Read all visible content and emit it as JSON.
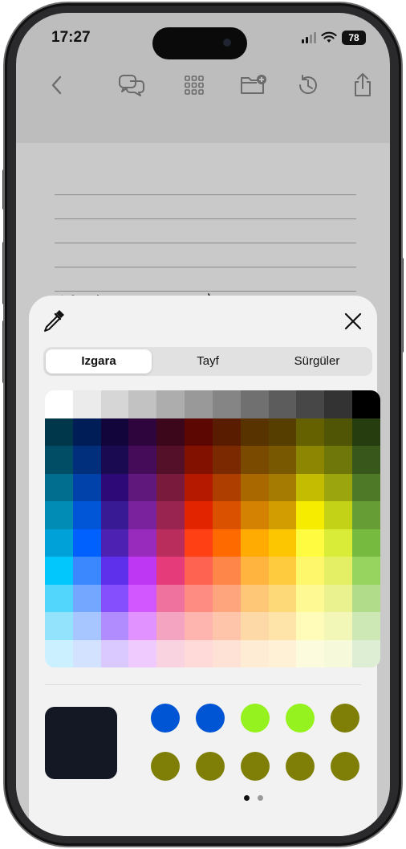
{
  "status_bar": {
    "time": "17:27",
    "battery": "78",
    "icons": [
      "signal-icon",
      "wifi-icon",
      "battery-icon"
    ]
  },
  "toolbar": {
    "icons": [
      "back-chevron-icon",
      "comments-icon",
      "grid-view-icon",
      "folder-add-icon",
      "history-icon",
      "share-icon"
    ]
  },
  "color_picker": {
    "picker_icon": "eyedropper-icon",
    "close_icon": "close-icon",
    "tabs": [
      {
        "label": "Izgara",
        "selected": true
      },
      {
        "label": "Tayf",
        "selected": false
      },
      {
        "label": "Sürgüler",
        "selected": false
      }
    ],
    "grid_colors": [
      [
        "#ffffff",
        "#ebebeb",
        "#d6d6d6",
        "#c2c2c2",
        "#adadad",
        "#999999",
        "#858585",
        "#707070",
        "#5c5c5c",
        "#474747",
        "#333333",
        "#000000"
      ],
      [
        "#00374a",
        "#011d57",
        "#11053b",
        "#2e063d",
        "#3c071b",
        "#5c0701",
        "#5a1c00",
        "#583300",
        "#563d00",
        "#666100",
        "#4f5504",
        "#263e0f"
      ],
      [
        "#004d65",
        "#012f7b",
        "#1a0a52",
        "#450d59",
        "#551029",
        "#831100",
        "#7b2900",
        "#7a4a00",
        "#785800",
        "#8c8602",
        "#6f760a",
        "#38571a"
      ],
      [
        "#016e8f",
        "#0042a9",
        "#2c0977",
        "#61187c",
        "#791a3d",
        "#b51a00",
        "#ad3e00",
        "#a96800",
        "#a67b01",
        "#c4bc00",
        "#9ba50e",
        "#4e7a27"
      ],
      [
        "#008cb4",
        "#0056d6",
        "#371a94",
        "#7a219e",
        "#99244f",
        "#e22400",
        "#da5100",
        "#d38301",
        "#d19d01",
        "#f5ec00",
        "#c3d117",
        "#669d34"
      ],
      [
        "#00a1d8",
        "#0061fe",
        "#4d22b2",
        "#982abc",
        "#b92d5d",
        "#ff4015",
        "#ff6a00",
        "#ffab01",
        "#fcc700",
        "#fefb41",
        "#d9ec37",
        "#76bb40"
      ],
      [
        "#01c7fc",
        "#3a87fe",
        "#5e30eb",
        "#be38f3",
        "#e63b7a",
        "#fe6250",
        "#fe8648",
        "#feb43f",
        "#fecb3e",
        "#fff76b",
        "#e4ef65",
        "#96d35f"
      ],
      [
        "#52d6fc",
        "#74a7ff",
        "#864ffe",
        "#d357fe",
        "#ee719e",
        "#ff8c82",
        "#fea57d",
        "#fec777",
        "#fed977",
        "#fff994",
        "#eaf28f",
        "#b1dd8b"
      ],
      [
        "#93e3fc",
        "#a7c6ff",
        "#b18cfe",
        "#e292fe",
        "#f4a4c0",
        "#ffb5af",
        "#ffc5ab",
        "#fed9a8",
        "#fee4a8",
        "#fffbb9",
        "#f2f7b7",
        "#cde8b5"
      ],
      [
        "#cbf0ff",
        "#d3e2ff",
        "#d9c9fe",
        "#efcaff",
        "#f9d3e0",
        "#ffdad8",
        "#ffe2d6",
        "#feecd4",
        "#fef1d5",
        "#fdfbdd",
        "#f6fadb",
        "#deeed4"
      ]
    ],
    "current_color": "#141824",
    "favorites": [
      "#0055d4",
      "#0055d4",
      "#95f21e",
      "#95f21e",
      "#7f7f08",
      "#7f7f08",
      "#7f7f08",
      "#7f7f08",
      "#7f7f08",
      "#7f7f08"
    ],
    "pager": {
      "total": 2,
      "current": 1
    }
  }
}
